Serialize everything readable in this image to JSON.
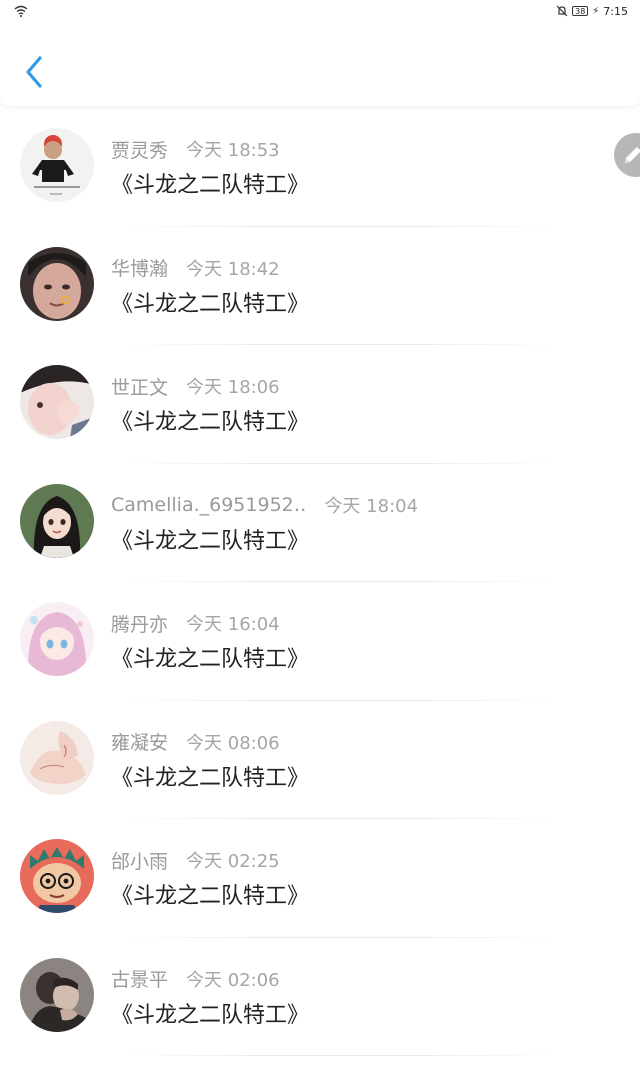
{
  "status_bar": {
    "battery_level": "38",
    "time": "7:15",
    "icons": [
      "wifi-icon",
      "mute-icon",
      "battery-icon",
      "charging-bolt-icon"
    ]
  },
  "header": {
    "back_icon": "chevron-left-icon",
    "accent_color": "#2f9ae6"
  },
  "fab": {
    "icon": "pencil-icon",
    "color": "#b7b7b7"
  },
  "comments": [
    {
      "username": "贾灵秀",
      "time": "今天  18:53",
      "message": "《斗龙之二队特工》"
    },
    {
      "username": "华博瀚",
      "time": "今天  18:42",
      "message": "《斗龙之二队特工》"
    },
    {
      "username": "世正文",
      "time": "今天  18:06",
      "message": "《斗龙之二队特工》"
    },
    {
      "username": "Camellia._6951952‥",
      "time": "今天  18:04",
      "message": "《斗龙之二队特工》"
    },
    {
      "username": "腾丹亦",
      "time": "今天  16:04",
      "message": "《斗龙之二队特工》"
    },
    {
      "username": "雍凝安",
      "time": "今天  08:06",
      "message": "《斗龙之二队特工》"
    },
    {
      "username": "邰小雨",
      "time": "今天  02:25",
      "message": "《斗龙之二队特工》"
    },
    {
      "username": "古景平",
      "time": "今天  02:06",
      "message": "《斗龙之二队特工》"
    }
  ]
}
